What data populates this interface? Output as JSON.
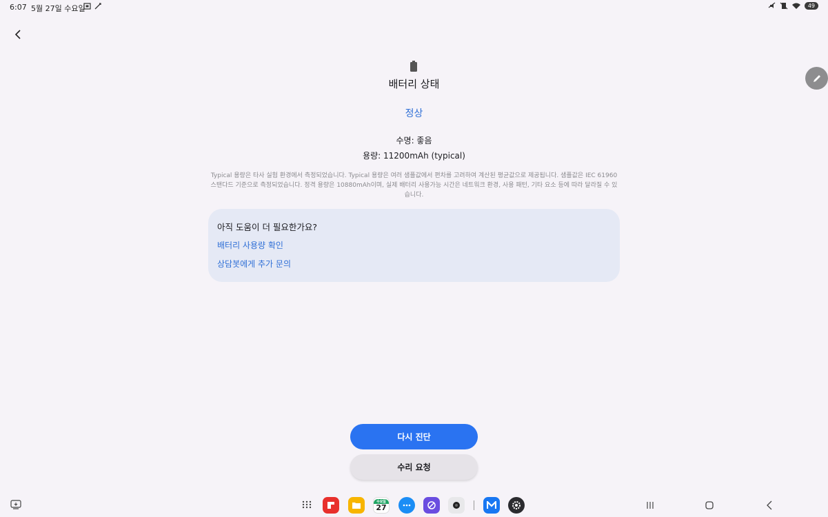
{
  "status_bar": {
    "time": "6:07",
    "date": "5월 27일 수요일",
    "battery_level": "49"
  },
  "main": {
    "title": "배터리 상태",
    "status": "정상",
    "lifespan": "수명: 좋음",
    "capacity": "용량: 11200mAh (typical)",
    "note": "Typical 용량은 타사 실험 환경에서 측정되었습니다. Typical 용량은 여러 샘플값에서 편차를 고려하여 계산된 평균값으로 제공됩니다. 샘플값은 IEC 61960 스탠다드 기준으로 측정되었습니다. 정격 용량은 10880mAh이며, 실제 배터리 사용가능 시간은 네트워크 환경, 사용 패턴, 기타 요소 등에 따라 달라질 수 있습니다."
  },
  "help_card": {
    "title": "아직 도움이 더 필요한가요?",
    "links": [
      "배터리 사용량 확인",
      "상담봇에게 추가 문의"
    ]
  },
  "buttons": {
    "rediagnose": "다시 진단",
    "repair": "수리 요청"
  },
  "dock": {
    "calendar_day": "27",
    "calendar_weekday": "수요일",
    "apps": [
      "flipboard-icon",
      "my-files-icon",
      "calendar-icon",
      "messages-icon",
      "internet-icon",
      "camera-icon",
      "members-icon",
      "settings-icon"
    ]
  },
  "colors": {
    "accent": "#2a73f1",
    "link": "#2f6fd6",
    "background": "#f6f3f8",
    "card": "#e5e9f5"
  }
}
